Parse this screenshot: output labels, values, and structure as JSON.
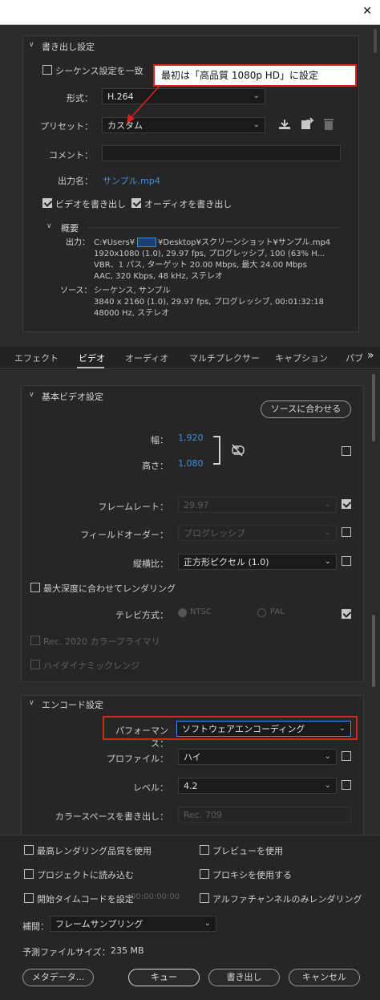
{
  "window": {
    "close_glyph": "✕"
  },
  "export_settings": {
    "header": "書き出し設定",
    "match_sequence_label": "シーケンス設定を一致",
    "format_label": "形式：",
    "format_value": "H.264",
    "preset_label": "プリセット：",
    "preset_value": "カスタム",
    "comment_label": "コメント：",
    "comment_value": "",
    "output_name_label": "出力名：",
    "output_name_value": "サンプル.mp4",
    "export_video_label": "ビデオを書き出し",
    "export_audio_label": "オーディオを書き出し",
    "summary_header": "概要",
    "output_key": "出力：",
    "output_lines": [
      "C:¥Users¥",
      "¥Desktop¥スクリーンショット¥サンプル.mp4",
      "1920x1080 (1.0), 29.97 fps, プログレッシブ, 100 (63% H...",
      "VBR、1 パス, ターゲット 20.00 Mbps, 最大 24.00 Mbps",
      "AAC, 320 Kbps, 48 kHz, ステレオ"
    ],
    "source_key": "ソース：",
    "source_lines": [
      "シーケンス, サンプル",
      "3840 x 2160 (1.0), 29.97 fps, プログレッシブ, 00:01:32:18",
      "48000 Hz, ステレオ"
    ]
  },
  "callout": {
    "text": "最初は「高品質 1080p HD」に設定"
  },
  "tabs": [
    "エフェクト",
    "ビデオ",
    "オーディオ",
    "マルチプレクサー",
    "キャプション",
    "パブ"
  ],
  "tabs_more_glyph": "»",
  "basic_video": {
    "header": "基本ビデオ設定",
    "match_source_button": "ソースに合わせる",
    "width_label": "幅：",
    "width_value": "1,920",
    "height_label": "高さ：",
    "height_value": "1,080",
    "frame_rate_label": "フレームレート：",
    "frame_rate_value": "29.97",
    "field_order_label": "フィールドオーダー：",
    "field_order_value": "プログレッシブ",
    "aspect_label": "縦横比：",
    "aspect_value": "正方形ピクセル (1.0)",
    "max_depth_label": "最大深度に合わせてレンダリング",
    "tv_standard_label": "テレビ方式：",
    "ntsc_label": "NTSC",
    "pal_label": "PAL",
    "rec2020_label": "Rec. 2020 カラープライマリ",
    "hdr_label": "ハイダイナミックレンジ"
  },
  "encode": {
    "header": "エンコード設定",
    "performance_label": "パフォーマンス：",
    "performance_value": "ソフトウェアエンコーディング",
    "profile_label": "プロファイル：",
    "profile_value": "ハイ",
    "level_label": "レベル：",
    "level_value": "4.2",
    "colorspace_label": "カラースペースを書き出し：",
    "colorspace_value": "Rec. 709"
  },
  "bottom": {
    "max_render_quality": "最高レンダリング品質を使用",
    "use_previews": "プレビューを使用",
    "import_into_project": "プロジェクトに読み込む",
    "use_proxies": "プロキシを使用する",
    "set_start_timecode": "開始タイムコードを設定",
    "timecode_value": "00:00:00:00",
    "alpha_only": "アルファチャンネルのみレンダリング",
    "interpolation_label": "補間：",
    "interpolation_value": "フレームサンプリング",
    "estimated_size_label": "予測ファイルサイズ：",
    "estimated_size_value": "235 MB",
    "metadata_button": "メタデータ...",
    "queue_button": "キュー",
    "export_button": "書き出し",
    "cancel_button": "キャンセル"
  }
}
